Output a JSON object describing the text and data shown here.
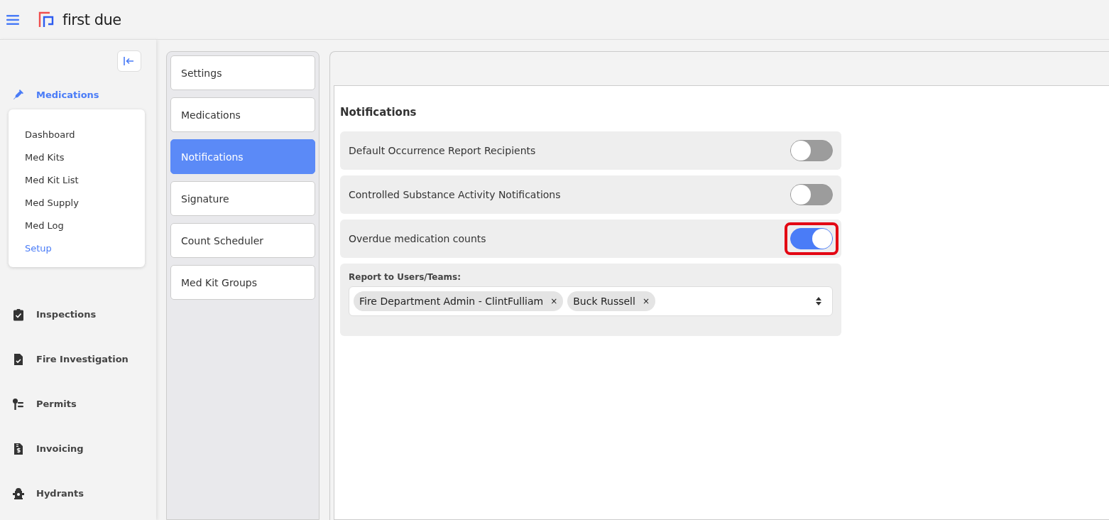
{
  "header": {
    "brand": "first due"
  },
  "sidebar": {
    "active_module": {
      "label": "Medications"
    },
    "submenu": [
      {
        "label": "Dashboard",
        "selected": false
      },
      {
        "label": "Med Kits",
        "selected": false
      },
      {
        "label": "Med Kit List",
        "selected": false
      },
      {
        "label": "Med Supply",
        "selected": false
      },
      {
        "label": "Med Log",
        "selected": false
      },
      {
        "label": "Setup",
        "selected": true
      }
    ],
    "modules": [
      {
        "label": "Inspections",
        "kind": "clipboard"
      },
      {
        "label": "Fire Investigation",
        "kind": "document"
      },
      {
        "label": "Permits",
        "kind": "key"
      },
      {
        "label": "Invoicing",
        "kind": "invoice"
      },
      {
        "label": "Hydrants",
        "kind": "hydrant"
      }
    ]
  },
  "setup_menu": [
    {
      "label": "Settings",
      "selected": false
    },
    {
      "label": "Medications",
      "selected": false
    },
    {
      "label": "Notifications",
      "selected": true
    },
    {
      "label": "Signature",
      "selected": false
    },
    {
      "label": "Count Scheduler",
      "selected": false
    },
    {
      "label": "Med Kit Groups",
      "selected": false
    }
  ],
  "notifications": {
    "title": "Notifications",
    "items": [
      {
        "label": "Default Occurrence Report Recipients",
        "on": false,
        "highlighted": false
      },
      {
        "label": "Controlled Substance Activity Notifications",
        "on": false,
        "highlighted": false
      },
      {
        "label": "Overdue medication counts",
        "on": true,
        "highlighted": true
      }
    ],
    "report_to": {
      "label": "Report to Users/Teams:",
      "tags": [
        "Fire Department Admin - ClintFulliam",
        "Buck Russell"
      ],
      "remove_mark": "×"
    }
  }
}
